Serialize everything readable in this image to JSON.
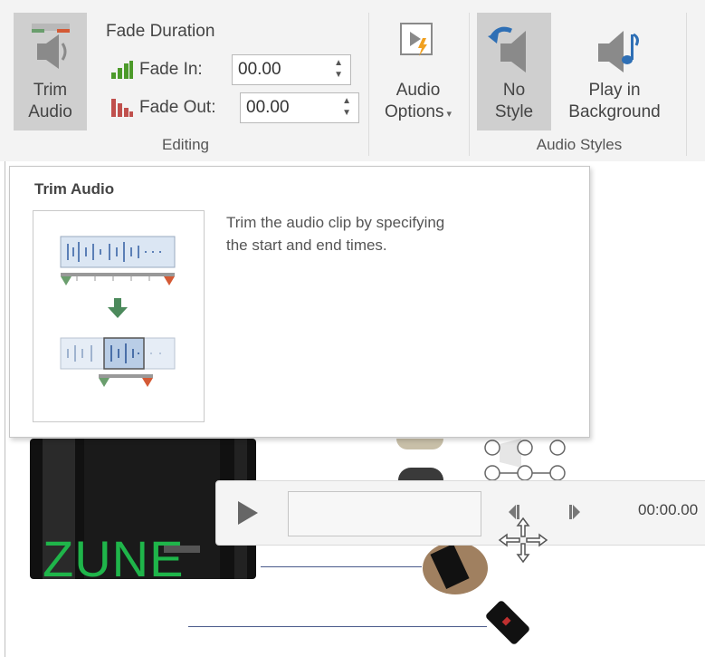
{
  "ribbon": {
    "trim_audio": {
      "line1": "Trim",
      "line2": "Audio"
    },
    "fade_duration": {
      "title": "Fade Duration",
      "fade_in_label": "Fade In:",
      "fade_in_value": "00.00",
      "fade_out_label": "Fade Out:",
      "fade_out_value": "00.00"
    },
    "audio_options": {
      "line1": "Audio",
      "line2": "Options"
    },
    "no_style": {
      "line1": "No",
      "line2": "Style"
    },
    "play_in_background": {
      "line1": "Play in",
      "line2": "Background"
    },
    "groups": {
      "editing": "Editing",
      "audio_styles": "Audio Styles"
    }
  },
  "tooltip": {
    "title": "Trim Audio",
    "description_line1": "Trim the audio clip by specifying",
    "description_line2": "the start and end times."
  },
  "player": {
    "time": "00:00.00"
  },
  "slide": {
    "brand_text": "ZUNE"
  },
  "colors": {
    "ribbon_bg": "#f3f3f3",
    "pressed": "#cfcfcf",
    "accent_green": "#1fb54a",
    "icon_blue": "#2e6fb5",
    "fade_green": "#4c9a2a",
    "fade_red": "#c0504d"
  }
}
